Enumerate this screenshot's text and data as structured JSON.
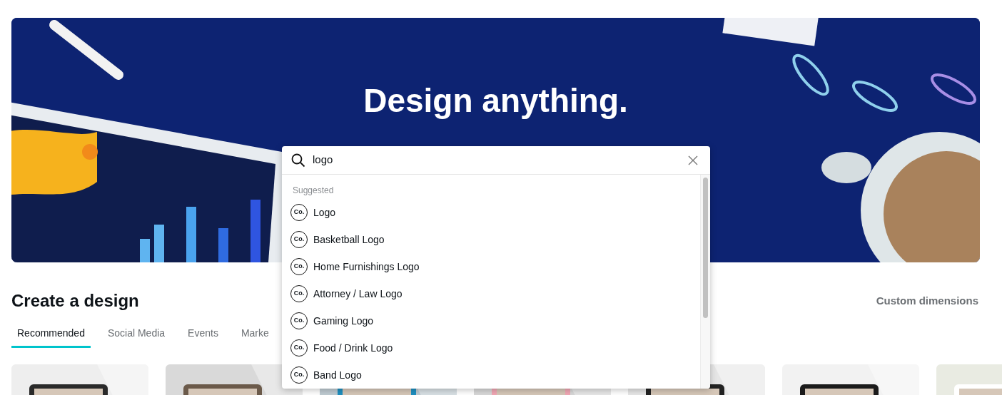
{
  "hero": {
    "kind": "picture",
    "title": "Design anything."
  },
  "search": {
    "value": "logo",
    "section_label": "Suggested",
    "suggestions": [
      {
        "badge": "Co.",
        "label": "Logo"
      },
      {
        "badge": "Co.",
        "label": "Basketball Logo"
      },
      {
        "badge": "Co.",
        "label": "Home Furnishings Logo"
      },
      {
        "badge": "Co.",
        "label": "Attorney / Law Logo"
      },
      {
        "badge": "Co.",
        "label": "Gaming Logo"
      },
      {
        "badge": "Co.",
        "label": "Food / Drink Logo"
      },
      {
        "badge": "Co.",
        "label": "Band Logo"
      }
    ]
  },
  "section": {
    "title": "Create a design",
    "link": "Custom dimensions"
  },
  "tabs": [
    {
      "label": "Recommended",
      "selected": true
    },
    {
      "label": "Social Media",
      "selected": false
    },
    {
      "label": "Events",
      "selected": false
    },
    {
      "label": "Marke",
      "selected": false
    }
  ]
}
